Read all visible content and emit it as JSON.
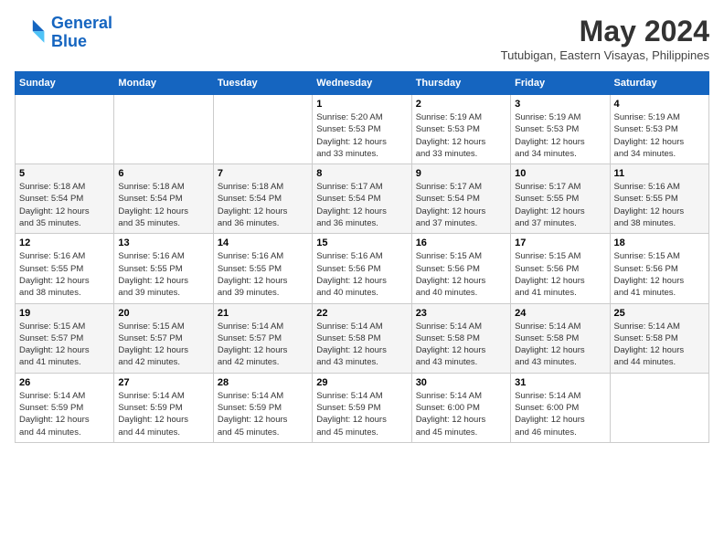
{
  "header": {
    "logo_line1": "General",
    "logo_line2": "Blue",
    "month_year": "May 2024",
    "location": "Tutubigan, Eastern Visayas, Philippines"
  },
  "days_of_week": [
    "Sunday",
    "Monday",
    "Tuesday",
    "Wednesday",
    "Thursday",
    "Friday",
    "Saturday"
  ],
  "weeks": [
    [
      {
        "day": "",
        "info": ""
      },
      {
        "day": "",
        "info": ""
      },
      {
        "day": "",
        "info": ""
      },
      {
        "day": "1",
        "info": "Sunrise: 5:20 AM\nSunset: 5:53 PM\nDaylight: 12 hours\nand 33 minutes."
      },
      {
        "day": "2",
        "info": "Sunrise: 5:19 AM\nSunset: 5:53 PM\nDaylight: 12 hours\nand 33 minutes."
      },
      {
        "day": "3",
        "info": "Sunrise: 5:19 AM\nSunset: 5:53 PM\nDaylight: 12 hours\nand 34 minutes."
      },
      {
        "day": "4",
        "info": "Sunrise: 5:19 AM\nSunset: 5:53 PM\nDaylight: 12 hours\nand 34 minutes."
      }
    ],
    [
      {
        "day": "5",
        "info": "Sunrise: 5:18 AM\nSunset: 5:54 PM\nDaylight: 12 hours\nand 35 minutes."
      },
      {
        "day": "6",
        "info": "Sunrise: 5:18 AM\nSunset: 5:54 PM\nDaylight: 12 hours\nand 35 minutes."
      },
      {
        "day": "7",
        "info": "Sunrise: 5:18 AM\nSunset: 5:54 PM\nDaylight: 12 hours\nand 36 minutes."
      },
      {
        "day": "8",
        "info": "Sunrise: 5:17 AM\nSunset: 5:54 PM\nDaylight: 12 hours\nand 36 minutes."
      },
      {
        "day": "9",
        "info": "Sunrise: 5:17 AM\nSunset: 5:54 PM\nDaylight: 12 hours\nand 37 minutes."
      },
      {
        "day": "10",
        "info": "Sunrise: 5:17 AM\nSunset: 5:55 PM\nDaylight: 12 hours\nand 37 minutes."
      },
      {
        "day": "11",
        "info": "Sunrise: 5:16 AM\nSunset: 5:55 PM\nDaylight: 12 hours\nand 38 minutes."
      }
    ],
    [
      {
        "day": "12",
        "info": "Sunrise: 5:16 AM\nSunset: 5:55 PM\nDaylight: 12 hours\nand 38 minutes."
      },
      {
        "day": "13",
        "info": "Sunrise: 5:16 AM\nSunset: 5:55 PM\nDaylight: 12 hours\nand 39 minutes."
      },
      {
        "day": "14",
        "info": "Sunrise: 5:16 AM\nSunset: 5:55 PM\nDaylight: 12 hours\nand 39 minutes."
      },
      {
        "day": "15",
        "info": "Sunrise: 5:16 AM\nSunset: 5:56 PM\nDaylight: 12 hours\nand 40 minutes."
      },
      {
        "day": "16",
        "info": "Sunrise: 5:15 AM\nSunset: 5:56 PM\nDaylight: 12 hours\nand 40 minutes."
      },
      {
        "day": "17",
        "info": "Sunrise: 5:15 AM\nSunset: 5:56 PM\nDaylight: 12 hours\nand 41 minutes."
      },
      {
        "day": "18",
        "info": "Sunrise: 5:15 AM\nSunset: 5:56 PM\nDaylight: 12 hours\nand 41 minutes."
      }
    ],
    [
      {
        "day": "19",
        "info": "Sunrise: 5:15 AM\nSunset: 5:57 PM\nDaylight: 12 hours\nand 41 minutes."
      },
      {
        "day": "20",
        "info": "Sunrise: 5:15 AM\nSunset: 5:57 PM\nDaylight: 12 hours\nand 42 minutes."
      },
      {
        "day": "21",
        "info": "Sunrise: 5:14 AM\nSunset: 5:57 PM\nDaylight: 12 hours\nand 42 minutes."
      },
      {
        "day": "22",
        "info": "Sunrise: 5:14 AM\nSunset: 5:58 PM\nDaylight: 12 hours\nand 43 minutes."
      },
      {
        "day": "23",
        "info": "Sunrise: 5:14 AM\nSunset: 5:58 PM\nDaylight: 12 hours\nand 43 minutes."
      },
      {
        "day": "24",
        "info": "Sunrise: 5:14 AM\nSunset: 5:58 PM\nDaylight: 12 hours\nand 43 minutes."
      },
      {
        "day": "25",
        "info": "Sunrise: 5:14 AM\nSunset: 5:58 PM\nDaylight: 12 hours\nand 44 minutes."
      }
    ],
    [
      {
        "day": "26",
        "info": "Sunrise: 5:14 AM\nSunset: 5:59 PM\nDaylight: 12 hours\nand 44 minutes."
      },
      {
        "day": "27",
        "info": "Sunrise: 5:14 AM\nSunset: 5:59 PM\nDaylight: 12 hours\nand 44 minutes."
      },
      {
        "day": "28",
        "info": "Sunrise: 5:14 AM\nSunset: 5:59 PM\nDaylight: 12 hours\nand 45 minutes."
      },
      {
        "day": "29",
        "info": "Sunrise: 5:14 AM\nSunset: 5:59 PM\nDaylight: 12 hours\nand 45 minutes."
      },
      {
        "day": "30",
        "info": "Sunrise: 5:14 AM\nSunset: 6:00 PM\nDaylight: 12 hours\nand 45 minutes."
      },
      {
        "day": "31",
        "info": "Sunrise: 5:14 AM\nSunset: 6:00 PM\nDaylight: 12 hours\nand 46 minutes."
      },
      {
        "day": "",
        "info": ""
      }
    ]
  ]
}
